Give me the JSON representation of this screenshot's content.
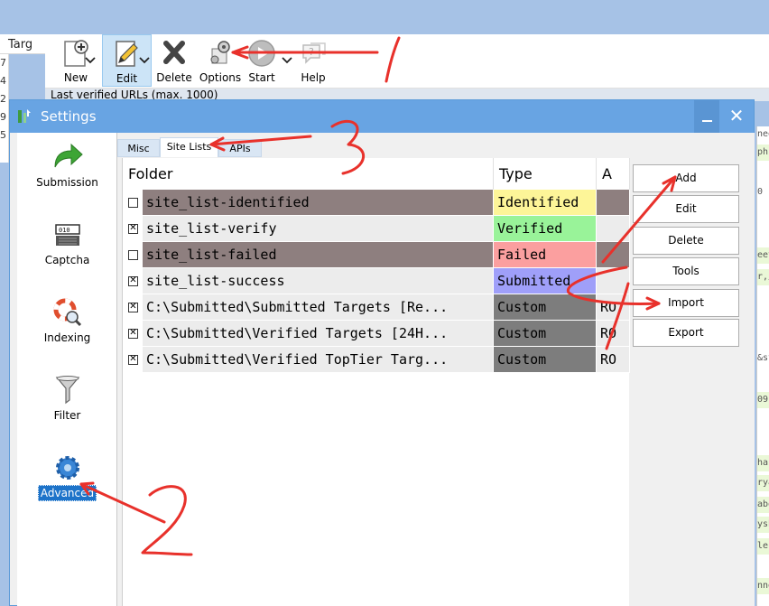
{
  "app": {
    "tab_label": "Targ",
    "left_numbers": [
      "7",
      "4",
      "2",
      "9",
      "5"
    ],
    "toolbar": [
      {
        "label": "New",
        "icon": "new-document-icon",
        "caret": true
      },
      {
        "label": "Edit",
        "icon": "edit-pencil-icon",
        "caret": true,
        "active": true
      },
      {
        "label": "Delete",
        "icon": "delete-x-icon",
        "caret": false
      },
      {
        "label": "Options",
        "icon": "options-gear-icon",
        "caret": false
      },
      {
        "label": "Start",
        "icon": "start-play-icon",
        "caret": true
      },
      {
        "label": "Help",
        "icon": "help-bubble-icon",
        "caret": false
      }
    ],
    "status_text": "Last verified URLs (max. 1000)",
    "right_snippets": [
      "nee",
      "ph",
      "0",
      "eet",
      "r,/",
      "&st",
      "09",
      "har",
      "rya",
      "abo",
      "ysh",
      "lec",
      "nne"
    ]
  },
  "dialog": {
    "title": "Settings",
    "close_label": "✕",
    "categories": [
      {
        "label": "Submission",
        "icon": "green-arrow-icon"
      },
      {
        "label": "Captcha",
        "icon": "captcha-keyboard-icon"
      },
      {
        "label": "Indexing",
        "icon": "lifebuoy-magnifier-icon"
      },
      {
        "label": "Filter",
        "icon": "funnel-icon"
      },
      {
        "label": "Advanced",
        "icon": "gear-icon",
        "selected": true
      }
    ],
    "tabs": [
      {
        "label": "Misc"
      },
      {
        "label": "Site Lists",
        "active": true
      },
      {
        "label": "APIs"
      }
    ],
    "table": {
      "columns": [
        "Folder",
        "Type",
        "A"
      ],
      "rows": [
        {
          "checked": false,
          "folder": "site_list-identified",
          "type": "Identified",
          "access": "",
          "folder_bg": "#8e7f7f",
          "type_bg": "#fdf598",
          "access_bg": "#8e7f7f"
        },
        {
          "checked": true,
          "folder": "site_list-verify",
          "type": "Verified",
          "access": "",
          "folder_bg": "#ececec",
          "type_bg": "#99f399",
          "access_bg": "#ececec"
        },
        {
          "checked": false,
          "folder": "site_list-failed",
          "type": "Failed",
          "access": "",
          "folder_bg": "#8e7f7f",
          "type_bg": "#fb9f9f",
          "access_bg": "#8e7f7f"
        },
        {
          "checked": true,
          "folder": "site_list-success",
          "type": "Submitted",
          "access": "",
          "folder_bg": "#ececec",
          "type_bg": "#9f9ff9",
          "access_bg": "#ececec"
        },
        {
          "checked": true,
          "folder": "C:\\Submitted\\Submitted Targets [Re...",
          "type": "Custom",
          "access": "RO",
          "folder_bg": "#ececec",
          "type_bg": "#7d7d7d",
          "access_bg": "#ececec"
        },
        {
          "checked": true,
          "folder": "C:\\Submitted\\Verified Targets [24H...",
          "type": "Custom",
          "access": "RO",
          "folder_bg": "#ececec",
          "type_bg": "#7d7d7d",
          "access_bg": "#ececec"
        },
        {
          "checked": true,
          "folder": "C:\\Submitted\\Verified TopTier Targ...",
          "type": "Custom",
          "access": "RO",
          "folder_bg": "#ececec",
          "type_bg": "#7d7d7d",
          "access_bg": "#ececec"
        }
      ]
    },
    "buttons": [
      "Add",
      "Edit",
      "Delete",
      "Tools",
      "Import",
      "Export"
    ]
  },
  "colors": {
    "annotation": "#e8312b",
    "dialog_title": "#68a4e3",
    "selection": "#1d73c9"
  }
}
